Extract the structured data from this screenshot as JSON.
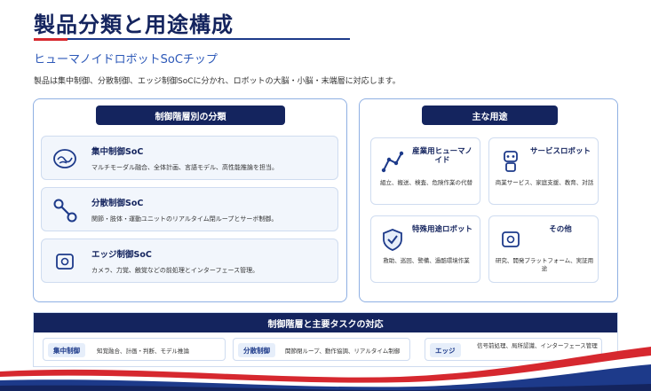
{
  "header": {
    "title": "製品分類と用途構成",
    "subtitle": "ヒューマノイドロボットSoCチップ",
    "description": "製品は集中制御、分散制御、エッジ制御SoCに分かれ、ロボットの大脳・小脳・末端層に対応します。"
  },
  "left_panel": {
    "heading": "制御階層別の分類",
    "items": [
      {
        "name": "集中制御SoC",
        "text": "マルチモーダル融合、全体計画、言語モデル、高性能推論を担当。",
        "icon": "brain-icon"
      },
      {
        "name": "分散制御SoC",
        "text": "関節・肢体・運動ユニットのリアルタイム閉ループとサーボ制御。",
        "icon": "joint-link-icon"
      },
      {
        "name": "エッジ制御SoC",
        "text": "カメラ、力覚、触覚などの前処理とインターフェース管理。",
        "icon": "chip-icon"
      }
    ]
  },
  "right_panel": {
    "heading": "主な用途",
    "items": [
      {
        "name": "産業用ヒューマノイド",
        "text": "組立、搬送、検査、危険作業の代替",
        "icon": "robot-arm-icon"
      },
      {
        "name": "サービスロボット",
        "text": "商業サービス、家庭支援、教育、対話",
        "icon": "service-robot-icon"
      },
      {
        "name": "特殊用途ロボット",
        "text": "救助、巡回、警備、過酷環境作業",
        "icon": "shield-check-icon"
      },
      {
        "name": "その他",
        "text": "研究、開発プラットフォーム、実証用途",
        "icon": "chip-icon"
      }
    ]
  },
  "mapping": {
    "heading": "制御階層と主要タスクの対応",
    "items": [
      {
        "tag": "集中制御",
        "text": "知覚融合、計画・判断、モデル推論"
      },
      {
        "tag": "分散制御",
        "text": "関節閉ループ、動作協調、リアルタイム制御"
      },
      {
        "tag": "エッジ",
        "text": "信号前処理、局所認識、インターフェース管理"
      }
    ]
  },
  "colors": {
    "navy": "#14245e",
    "accent_blue": "#2c58b8",
    "accent_red": "#d6282f",
    "card_bg": "#f2f6fc"
  }
}
